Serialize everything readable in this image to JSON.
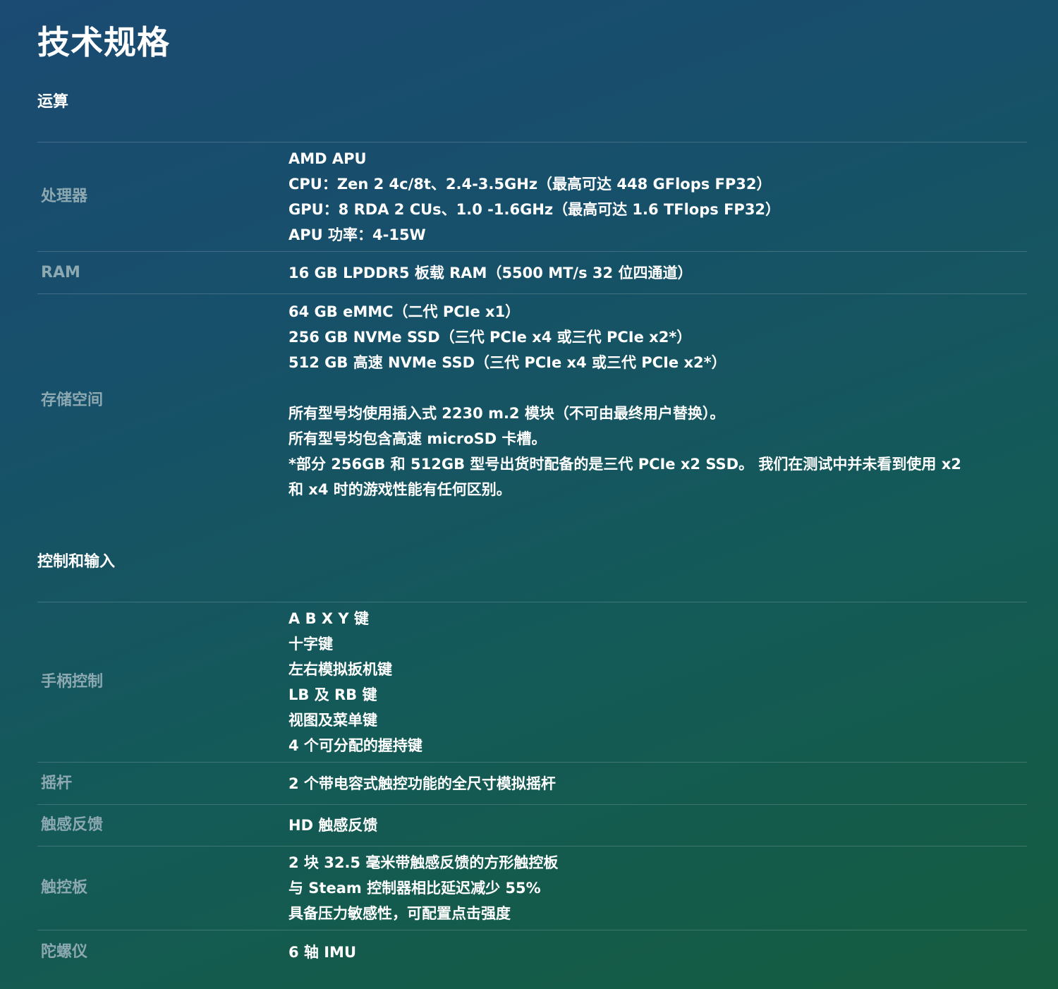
{
  "page_title": "技术规格",
  "sections": [
    {
      "heading": "运算",
      "rows": [
        {
          "label": "处理器",
          "lines": [
            "AMD APU",
            "CPU：Zen 2 4c/8t、2.4-3.5GHz（最高可达 448 GFlops FP32）",
            "GPU：8 RDA 2 CUs、1.0 -1.6GHz（最高可达 1.6 TFlops FP32）",
            "APU 功率：4-15W"
          ]
        },
        {
          "label": "RAM",
          "lines": [
            "16 GB LPDDR5 板载 RAM（5500 MT/s 32 位四通道）"
          ]
        },
        {
          "label": "存储空间",
          "lines": [
            "64 GB eMMC（二代 PCIe x1）",
            "256 GB NVMe SSD（三代 PCIe x4 或三代 PCIe x2*）",
            "512 GB 高速 NVMe SSD（三代 PCIe x4 或三代 PCIe x2*）",
            "",
            "所有型号均使用插入式 2230 m.2 模块（不可由最终用户替换）。",
            "所有型号均包含高速 microSD 卡槽。",
            "*部分 256GB 和 512GB 型号出货时配备的是三代 PCIe x2 SSD。 我们在测试中并未看到使用 x2",
            "和 x4 时的游戏性能有任何区别。"
          ]
        }
      ]
    },
    {
      "heading": "控制和输入",
      "rows": [
        {
          "label": "手柄控制",
          "lines": [
            "A B X Y 键",
            "十字键",
            "左右模拟扳机键",
            "LB 及 RB 键",
            "视图及菜单键",
            "4 个可分配的握持键"
          ]
        },
        {
          "label": "摇杆",
          "lines": [
            "2 个带电容式触控功能的全尺寸模拟摇杆"
          ]
        },
        {
          "label": "触感反馈",
          "lines": [
            "HD 触感反馈"
          ]
        },
        {
          "label": "触控板",
          "lines": [
            "2 块 32.5 毫米带触感反馈的方形触控板",
            "与 Steam 控制器相比延迟减少 55%",
            "具备压力敏感性，可配置点击强度"
          ]
        },
        {
          "label": "陀螺仪",
          "lines": [
            "6 轴 IMU"
          ]
        }
      ]
    }
  ]
}
